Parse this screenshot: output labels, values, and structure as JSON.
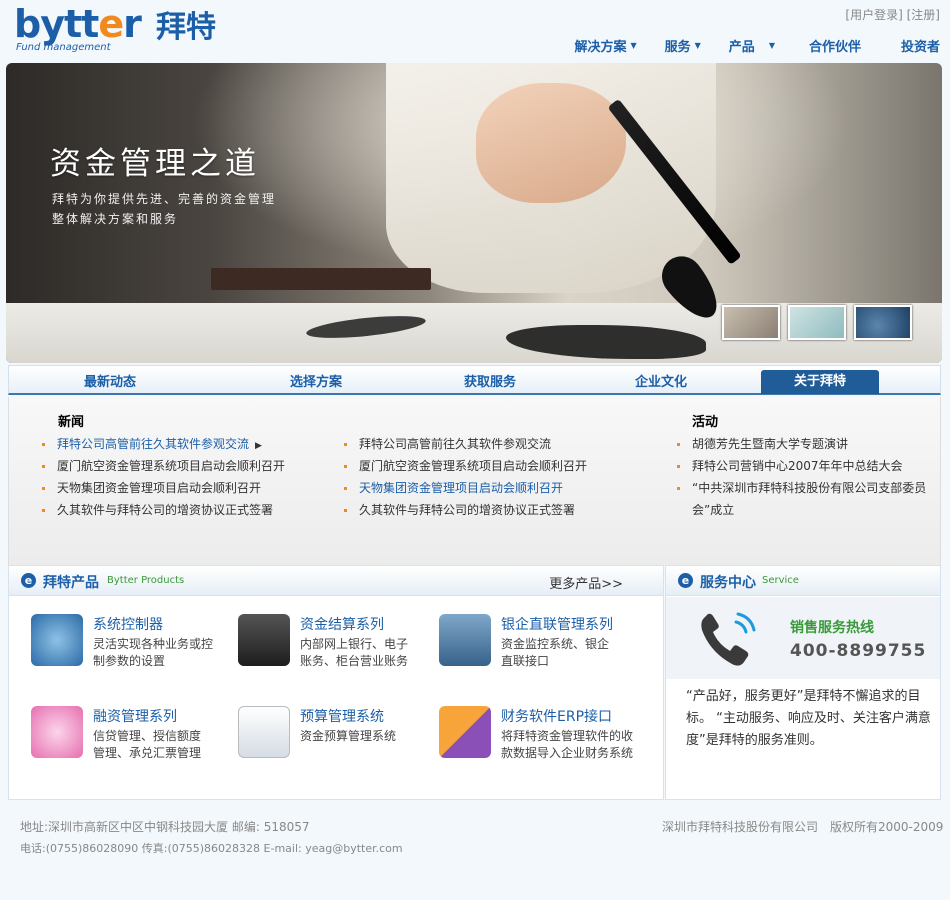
{
  "brand": {
    "logo_en_a": "bytt",
    "logo_en_o": "e",
    "logo_en_b": "r",
    "logo_sub": "Fund management",
    "logo_cn": "拜特"
  },
  "top_links": {
    "login": "[用户登录]",
    "register": "[注册]"
  },
  "nav": [
    {
      "label": "解决方案",
      "caret": true
    },
    {
      "label": "服务",
      "caret": true
    },
    {
      "label": "产品",
      "caret": true
    },
    {
      "label": "合作伙伴",
      "caret": false
    },
    {
      "label": "投资者",
      "caret": false
    }
  ],
  "banner": {
    "title": "资金管理之道",
    "sub_line1": "拜特为你提供先进、完善的资金管理",
    "sub_line2": "整体解决方案和服务"
  },
  "tabs": [
    "最新动态",
    "选择方案",
    "获取服务",
    "企业文化",
    "关于拜特"
  ],
  "news": {
    "heading": "新闻",
    "items_left": [
      "拜特公司高管前往久其软件参观交流",
      "厦门航空资金管理系统项目启动会顺利召开",
      "天物集团资金管理项目启动会顺利召开",
      "久其软件与拜特公司的增资协议正式签署"
    ],
    "items_middle": [
      "拜特公司高管前往久其软件参观交流",
      "厦门航空资金管理系统项目启动会顺利召开",
      "天物集团资金管理项目启动会顺利召开",
      "久其软件与拜特公司的增资协议正式签署"
    ]
  },
  "events": {
    "heading": "活动",
    "items": [
      "胡德芳先生暨南大学专题演讲",
      "拜特公司营销中心2007年年中总结大会",
      "“中共深圳市拜特科技股份有限公司支部委员会”成立"
    ]
  },
  "products": {
    "title": "拜特产品",
    "subtitle": "Bytter Products",
    "more": "更多产品>>",
    "items": [
      {
        "title": "系统控制器",
        "desc": "灵活实现各种业务或控制参数的设置",
        "icon": "satellite-icon"
      },
      {
        "title": "资金结算系列",
        "desc": "内部网上银行、电子账务、柜台营业账务",
        "icon": "calculator-icon"
      },
      {
        "title": "银企直联管理系列",
        "desc": "资金监控系统、银企直联接口",
        "icon": "network-icon"
      },
      {
        "title": "融资管理系列",
        "desc": "信贷管理、授信额度管理、承兑汇票管理",
        "icon": "magic-wand-icon"
      },
      {
        "title": "预算管理系统",
        "desc": "资金预算管理系统",
        "icon": "report-icon"
      },
      {
        "title": "财务软件ERP接口",
        "desc": "将拜特资金管理软件的收款数据导入企业财务系统",
        "icon": "exchange-arrows-icon"
      }
    ]
  },
  "service": {
    "title": "服务中心",
    "subtitle": "Service",
    "hotline_label": "销售服务热线",
    "hotline_number": "400-8899755",
    "text": "“产品好，服务更好”是拜特不懈追求的目标。 “主动服务、响应及时、关注客户满意度”是拜特的服务准则。"
  },
  "footer": {
    "address": "地址:深圳市高新区中区中钢科技园大厦 邮编: 518057",
    "contact": "电话:(0755)86028090 传真:(0755)86028328 E-mail: yeag@bytter.com",
    "company": "深圳市拜特科技股份有限公司",
    "copyright": "版权所有2000-2009"
  },
  "colors": {
    "brand_blue": "#1c5fa8",
    "brand_orange": "#f08a1e",
    "accent_green": "#3a9a3a"
  }
}
